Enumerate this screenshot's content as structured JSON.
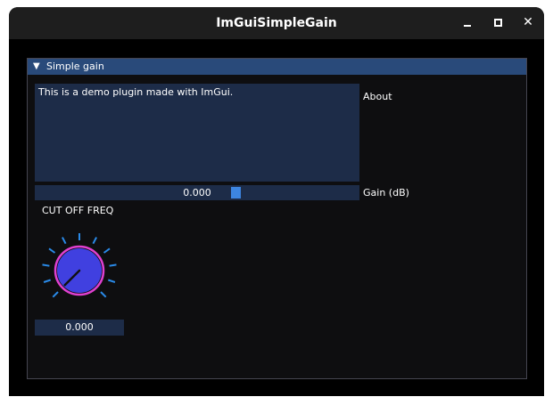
{
  "window": {
    "title": "ImGuiSimpleGain",
    "controls": {
      "minimize": "minimize-icon",
      "maximize": "maximize-icon",
      "close": "close-icon",
      "close_glyph": "✕"
    }
  },
  "panel": {
    "header_arrow": "▼",
    "header_label": "Simple gain",
    "about_text": "This is a demo plugin made with ImGui.",
    "about_label": "About",
    "gain_value": "0.000",
    "gain_label": "Gain (dB)",
    "gain_level": 0.625,
    "knob_label": "CUT OFF FREQ",
    "knob_value": "0.000",
    "knob_level": 0.0
  },
  "colors": {
    "header": "#294a7a",
    "frame": "#1d2c48",
    "accent": "#3d85e0",
    "knob_fill": "#4040e0",
    "knob_ring": "#e040d0",
    "tick": "#2a8ae8"
  }
}
